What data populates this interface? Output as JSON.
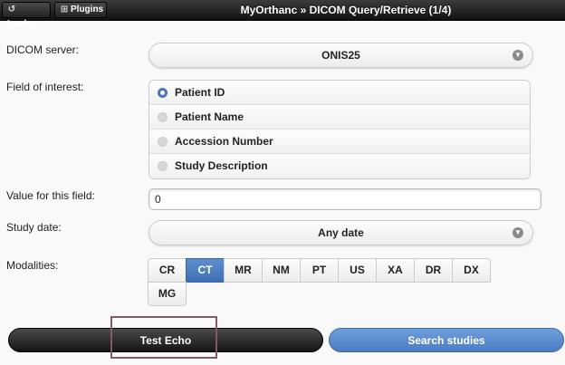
{
  "header": {
    "title": "MyOrthanc » DICOM Query/Retrieve (1/4)",
    "lookup_label": "Lookup",
    "plugins_label": "Plugins"
  },
  "form": {
    "server_label": "DICOM server:",
    "server_value": "ONIS25",
    "field_label": "Field of interest:",
    "fields": [
      {
        "label": "Patient ID",
        "selected": true
      },
      {
        "label": "Patient Name",
        "selected": false
      },
      {
        "label": "Accession Number",
        "selected": false
      },
      {
        "label": "Study Description",
        "selected": false
      }
    ],
    "value_label": "Value for this field:",
    "value_text": "0",
    "date_label": "Study date:",
    "date_value": "Any date",
    "modalities_label": "Modalities:",
    "modalities": [
      {
        "label": "CR",
        "selected": false
      },
      {
        "label": "CT",
        "selected": true
      },
      {
        "label": "MR",
        "selected": false
      },
      {
        "label": "NM",
        "selected": false
      },
      {
        "label": "PT",
        "selected": false
      },
      {
        "label": "US",
        "selected": false
      },
      {
        "label": "XA",
        "selected": false
      },
      {
        "label": "DR",
        "selected": false
      },
      {
        "label": "DX",
        "selected": false
      },
      {
        "label": "MG",
        "selected": false
      }
    ]
  },
  "buttons": {
    "echo_label": "Test Echo",
    "search_label": "Search studies"
  },
  "colors": {
    "accent": "#4a76b8",
    "header": "#222222",
    "highlight_box": "#7f5b67"
  }
}
